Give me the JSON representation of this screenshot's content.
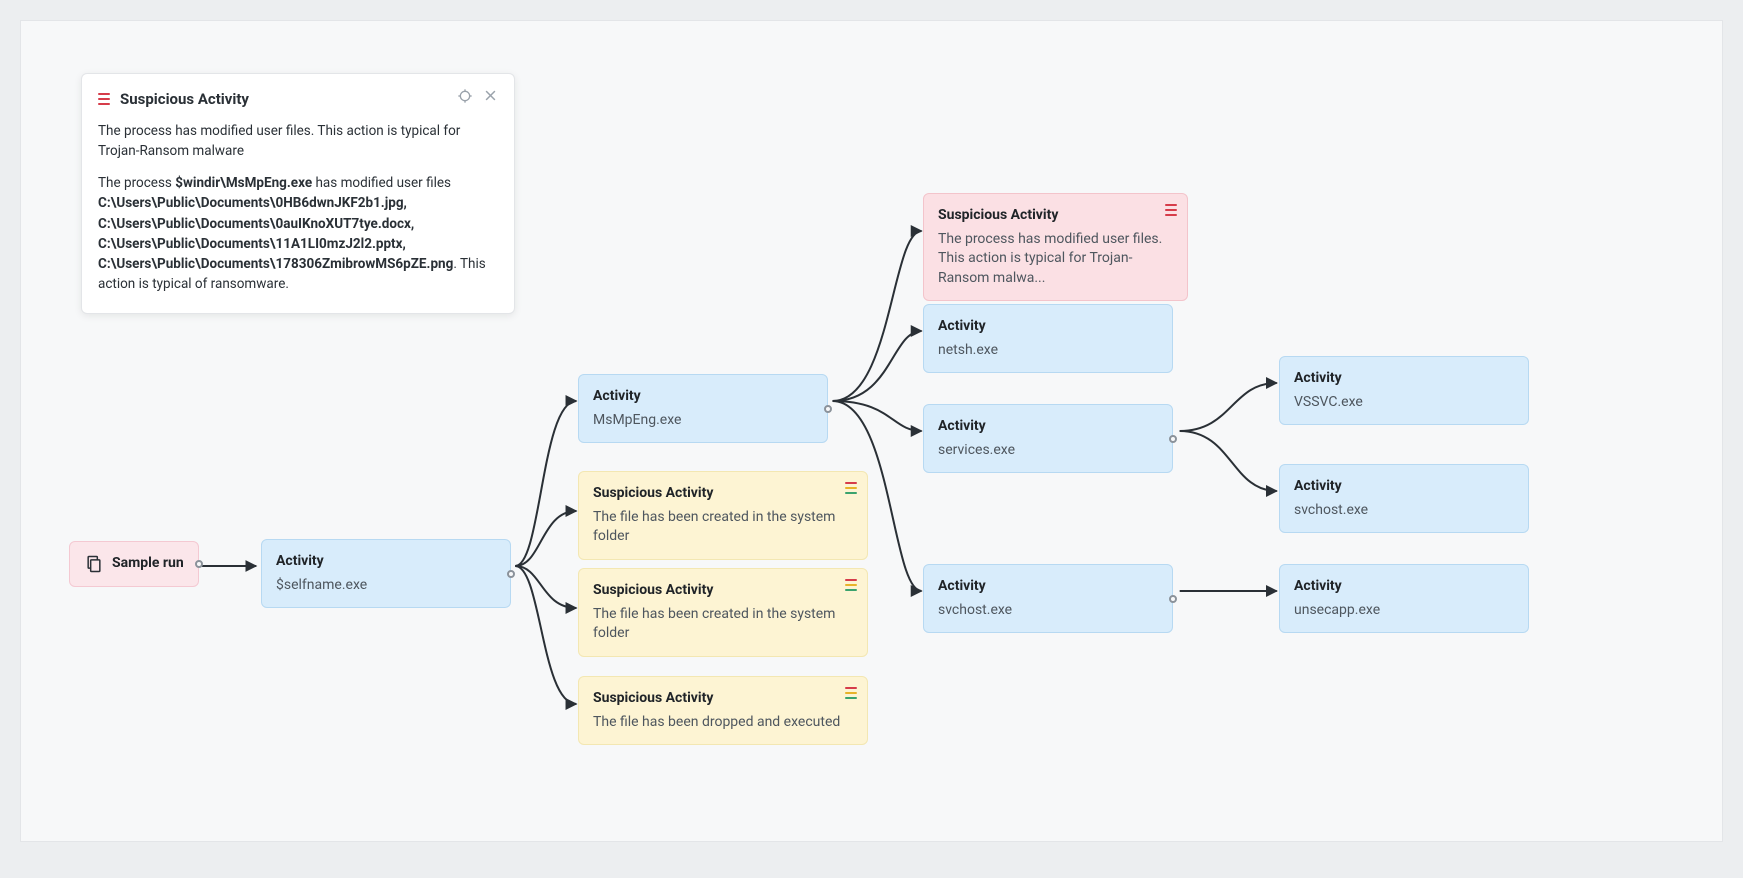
{
  "tooltip": {
    "title": "Suspicious Activity",
    "summary": "The process has modified user files. This action is typical for Trojan-Ransom malware",
    "detail_pre": "The process ",
    "bold_process": "$windir\\MsMpEng.exe",
    "detail_mid": " has modified user files ",
    "bold_files": "C:\\Users\\Public\\Documents\\0HB6dwnJKF2b1.jpg, C:\\Users\\Public\\Documents\\0auIKnoXUT7tye.docx, C:\\Users\\Public\\Documents\\11A1LI0mzJ2l2.pptx, C:\\Users\\Public\\Documents\\178306ZmibrowMS6pZE.png",
    "detail_post": ". This action is typical of ransomware."
  },
  "nodes": {
    "sample": {
      "title": "Sample run"
    },
    "act_root": {
      "title": "Activity",
      "sub": "$selfname.exe"
    },
    "act_msmp": {
      "title": "Activity",
      "sub": "MsMpEng.exe"
    },
    "susp_y1": {
      "title": "Suspicious Activity",
      "sub": "The file has been created in the system folder"
    },
    "susp_y2": {
      "title": "Suspicious Activity",
      "sub": "The file has been created in the system folder"
    },
    "susp_y3": {
      "title": "Suspicious Activity",
      "sub": "The file has been dropped and executed"
    },
    "susp_red": {
      "title": "Suspicious Activity",
      "sub": "The process has modified user files. This action is typical for Trojan-Ransom malwa..."
    },
    "act_netsh": {
      "title": "Activity",
      "sub": "netsh.exe"
    },
    "act_services": {
      "title": "Activity",
      "sub": "services.exe"
    },
    "act_svchost": {
      "title": "Activity",
      "sub": "svchost.exe"
    },
    "act_vssvc": {
      "title": "Activity",
      "sub": "VSSVC.exe"
    },
    "act_svchost2": {
      "title": "Activity",
      "sub": "svchost.exe"
    },
    "act_unsecapp": {
      "title": "Activity",
      "sub": "unsecapp.exe"
    }
  }
}
